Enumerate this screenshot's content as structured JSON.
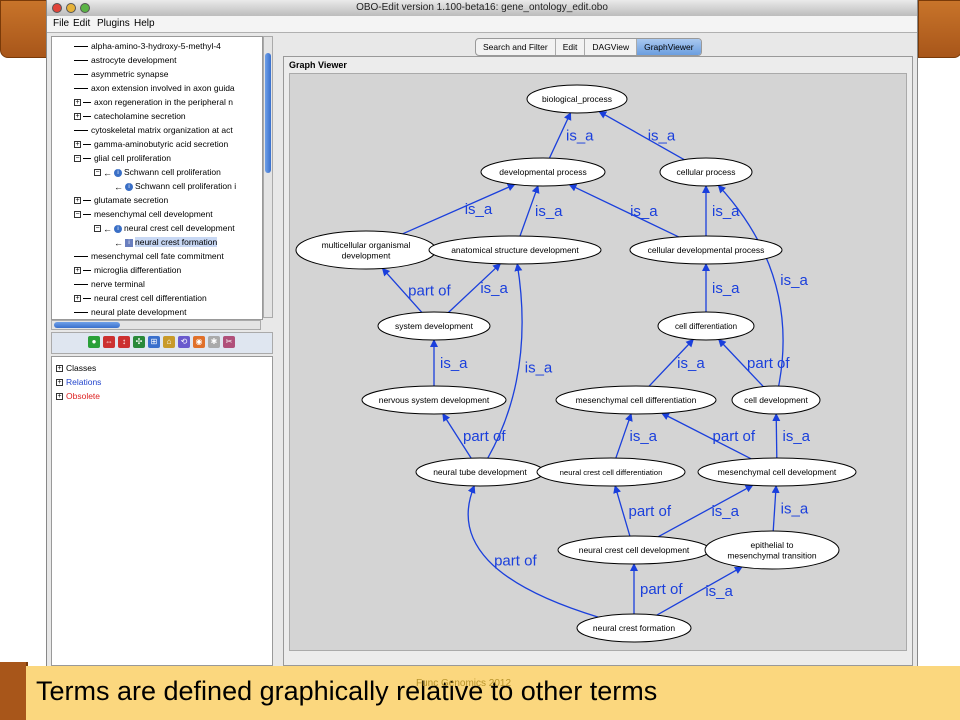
{
  "window": {
    "title": "OBO-Edit version 1.100-beta16: gene_ontology_edit.obo",
    "menu": [
      "File",
      "Edit",
      "Plugins",
      "Help"
    ]
  },
  "tree": [
    {
      "label": "alpha-amino-3-hydroxy-5-methyl-4",
      "kind": "leaf",
      "indent": 0
    },
    {
      "label": "astrocyte development",
      "kind": "leaf",
      "indent": 0
    },
    {
      "label": "asymmetric synapse",
      "kind": "leaf",
      "indent": 0
    },
    {
      "label": "axon extension involved in axon guida",
      "kind": "leaf",
      "indent": 0
    },
    {
      "label": "axon regeneration in the peripheral n",
      "kind": "plus",
      "indent": 0
    },
    {
      "label": "catecholamine secretion",
      "kind": "plus",
      "indent": 0
    },
    {
      "label": "cytoskeletal matrix organization at act",
      "kind": "leaf",
      "indent": 0
    },
    {
      "label": "gamma-aminobutyric acid secretion",
      "kind": "plus",
      "indent": 0
    },
    {
      "label": "glial cell proliferation",
      "kind": "minus",
      "indent": 0
    },
    {
      "label": "Schwann cell proliferation",
      "kind": "minus-arrow",
      "indent": 1
    },
    {
      "label": "Schwann cell proliferation i",
      "kind": "arrow",
      "indent": 2
    },
    {
      "label": "glutamate secretion",
      "kind": "plus",
      "indent": 0
    },
    {
      "label": "mesenchymal cell development",
      "kind": "minus",
      "indent": 0
    },
    {
      "label": "neural crest cell development",
      "kind": "minus-arrow",
      "indent": 1
    },
    {
      "label": "neural crest formation",
      "kind": "arrow-selected",
      "indent": 2
    },
    {
      "label": "mesenchymal cell fate commitment",
      "kind": "leaf",
      "indent": 0
    },
    {
      "label": "microglia differentiation",
      "kind": "plus",
      "indent": 0
    },
    {
      "label": "nerve terminal",
      "kind": "leaf",
      "indent": 0
    },
    {
      "label": "neural crest cell differentiation",
      "kind": "plus",
      "indent": 0
    },
    {
      "label": "neural plate development",
      "kind": "leaf",
      "indent": 0
    }
  ],
  "lower_tree": [
    {
      "label": "Classes",
      "color": "#000000"
    },
    {
      "label": "Relations",
      "color": "#2244cc"
    },
    {
      "label": "Obsolete",
      "color": "#dd2222"
    }
  ],
  "tabs": [
    "Search and Filter",
    "Edit",
    "DAGView",
    "GraphViewer"
  ],
  "active_tab": "GraphViewer",
  "graph_panel_title": "Graph Viewer",
  "graph": {
    "edge_color": "#1a3fdc",
    "nodes": [
      {
        "id": "bp",
        "label": "biological_process"
      },
      {
        "id": "dev",
        "label": "developmental process"
      },
      {
        "id": "cell",
        "label": "cellular process"
      },
      {
        "id": "multi",
        "label": "multicellular organismal development"
      },
      {
        "id": "anat",
        "label": "anatomical structure development"
      },
      {
        "id": "celldev",
        "label": "cellular developmental process"
      },
      {
        "id": "sys",
        "label": "system development"
      },
      {
        "id": "cdiff",
        "label": "cell differentiation"
      },
      {
        "id": "nerv",
        "label": "nervous system development"
      },
      {
        "id": "mesdiff",
        "label": "mesenchymal cell differentiation"
      },
      {
        "id": "celldevelop",
        "label": "cell development"
      },
      {
        "id": "ntube",
        "label": "neural tube development"
      },
      {
        "id": "ncdiff",
        "label": "neural crest cell differentiation"
      },
      {
        "id": "mesdev",
        "label": "mesenchymal cell development"
      },
      {
        "id": "ncdev",
        "label": "neural crest cell development"
      },
      {
        "id": "emt",
        "label": "epithelial to mesenchymal transition"
      },
      {
        "id": "ncf",
        "label": "neural crest formation"
      }
    ],
    "edges": [
      {
        "from": "dev",
        "to": "bp",
        "label": "is_a"
      },
      {
        "from": "cell",
        "to": "bp",
        "label": "is_a"
      },
      {
        "from": "multi",
        "to": "dev",
        "label": "is_a"
      },
      {
        "from": "anat",
        "to": "dev",
        "label": "is_a"
      },
      {
        "from": "celldev",
        "to": "dev",
        "label": "is_a"
      },
      {
        "from": "celldev",
        "to": "cell",
        "label": "is_a"
      },
      {
        "from": "sys",
        "to": "multi",
        "label": "part of"
      },
      {
        "from": "sys",
        "to": "anat",
        "label": "is_a"
      },
      {
        "from": "cdiff",
        "to": "celldev",
        "label": "is_a"
      },
      {
        "from": "celldevelop",
        "to": "cell",
        "label": "is_a"
      },
      {
        "from": "nerv",
        "to": "sys",
        "label": "is_a"
      },
      {
        "from": "ntube",
        "to": "anat",
        "label": "is_a"
      },
      {
        "from": "mesdiff",
        "to": "cdiff",
        "label": "is_a"
      },
      {
        "from": "celldevelop",
        "to": "cdiff",
        "label": "part of"
      },
      {
        "from": "ntube",
        "to": "nerv",
        "label": "part of"
      },
      {
        "from": "ncdiff",
        "to": "mesdiff",
        "label": "is_a"
      },
      {
        "from": "mesdev",
        "to": "mesdiff",
        "label": "part of"
      },
      {
        "from": "mesdev",
        "to": "celldevelop",
        "label": "is_a"
      },
      {
        "from": "ncdev",
        "to": "ncdiff",
        "label": "part of"
      },
      {
        "from": "ncdev",
        "to": "mesdev",
        "label": "is_a"
      },
      {
        "from": "emt",
        "to": "mesdev",
        "label": "is_a"
      },
      {
        "from": "ncf",
        "to": "ntube",
        "label": "part of"
      },
      {
        "from": "ncf",
        "to": "ncdev",
        "label": "part of"
      },
      {
        "from": "ncf",
        "to": "emt",
        "label": "is_a"
      }
    ]
  },
  "caption": "Terms are defined graphically relative to other terms",
  "footer": "Func Genomics 2012"
}
